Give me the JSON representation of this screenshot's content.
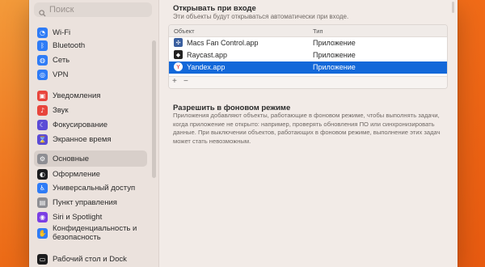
{
  "sidebar": {
    "search_placeholder": "Поиск",
    "items": [
      {
        "label": "Wi-Fi",
        "icon": "wifi-icon",
        "color": "#2f7cf6",
        "glyph": "◔"
      },
      {
        "label": "Bluetooth",
        "icon": "bluetooth-icon",
        "color": "#2f7cf6",
        "glyph": "ᛒ"
      },
      {
        "label": "Сеть",
        "icon": "network-icon",
        "color": "#2f7cf6",
        "glyph": "◍"
      },
      {
        "label": "VPN",
        "icon": "vpn-icon",
        "color": "#2f7cf6",
        "glyph": "◎"
      },
      {
        "label": "Уведомления",
        "icon": "notifications-icon",
        "color": "#e8453c",
        "glyph": "▣"
      },
      {
        "label": "Звук",
        "icon": "sound-icon",
        "color": "#e8453c",
        "glyph": "♪"
      },
      {
        "label": "Фокусирование",
        "icon": "focus-icon",
        "color": "#5b4bd6",
        "glyph": "☾"
      },
      {
        "label": "Экранное время",
        "icon": "screen-time-icon",
        "color": "#5b4bd6",
        "glyph": "⌛"
      },
      {
        "label": "Основные",
        "icon": "general-icon",
        "color": "#8e8e93",
        "glyph": "⚙"
      },
      {
        "label": "Оформление",
        "icon": "appearance-icon",
        "color": "#1c1c1e",
        "glyph": "◐"
      },
      {
        "label": "Универсальный доступ",
        "icon": "accessibility-icon",
        "color": "#2f7cf6",
        "glyph": "♿"
      },
      {
        "label": "Пункт управления",
        "icon": "control-center-icon",
        "color": "#8e8e93",
        "glyph": "▤"
      },
      {
        "label": "Siri и Spotlight",
        "icon": "siri-icon",
        "color": "#7b3fe4",
        "glyph": "◉"
      },
      {
        "label": "Конфиденциальность и безопасность",
        "icon": "privacy-icon",
        "color": "#2f7cf6",
        "glyph": "✋"
      },
      {
        "label": "Рабочий стол и Dock",
        "icon": "desktop-dock-icon",
        "color": "#1c1c1e",
        "glyph": "▭"
      }
    ]
  },
  "login_items": {
    "title": "Открывать при входе",
    "subtitle": "Эти объекты будут открываться автоматически при входе.",
    "col_object": "Объект",
    "col_type": "Тип",
    "rows": [
      {
        "name": "Macs Fan Control.app",
        "type": "Приложение",
        "icon": "macs-fan-control-icon",
        "color": "#3a5f9f",
        "glyph": "✣"
      },
      {
        "name": "Raycast.app",
        "type": "Приложение",
        "icon": "raycast-icon",
        "color": "#222222",
        "glyph": "◆"
      },
      {
        "name": "Yandex.app",
        "type": "Приложение",
        "icon": "yandex-icon",
        "color": "#ffffff",
        "glyph": "Y"
      }
    ],
    "add_label": "+",
    "remove_label": "−"
  },
  "background": {
    "title": "Разрешить в фоновом режиме",
    "description": "Приложения добавляют объекты, работающие в фоновом режиме, чтобы выполнять задачи, когда приложение не открыто: например, проверять обновления ПО или синхронизировать данные. При выключении объектов, работающих в фоновом режиме, выполнение этих задач может стать невозможным."
  },
  "colors": {
    "accent": "#1368d9",
    "window_bg": "#f2ebe7",
    "sidebar_bg": "#ebe2dd"
  }
}
